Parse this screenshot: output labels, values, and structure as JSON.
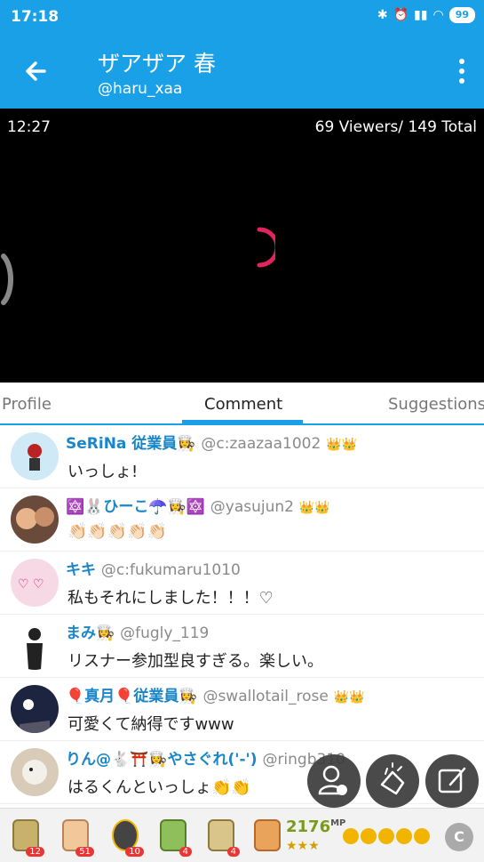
{
  "status": {
    "time": "17:18",
    "battery": "99"
  },
  "appbar": {
    "title": "ザアザア 春",
    "handle": "@haru_xaa"
  },
  "video": {
    "time": "12:27",
    "viewers": "69 Viewers/ 149 Total"
  },
  "tabs": [
    "Profile",
    "Comment",
    "Suggestions"
  ],
  "comments": [
    {
      "name": "SeRiNa 従業員👩‍🍳",
      "user": "@c:zaazaa1002",
      "badge": "👑👑",
      "message": "いっしょ!"
    },
    {
      "name": "🔯🐰ひーこ☂️👩‍🍳🔯",
      "user": "@yasujun2",
      "badge": "👑👑",
      "message": "👏🏻👏🏻👏🏻👏🏻👏🏻"
    },
    {
      "name": "キキ",
      "user": "@c:fukumaru1010",
      "badge": "",
      "message": "私もそれにしました！！！♡"
    },
    {
      "name": "まみ👩‍🍳",
      "user": "@fugly_119",
      "badge": "",
      "message": "リスナー参加型良すぎる。楽しい。"
    },
    {
      "name": "🎈真月🎈従業員👩‍🍳",
      "user": "@swallotail_rose",
      "badge": "👑👑",
      "message": "可愛くて納得ですwww"
    },
    {
      "name": "りん@🐇⛩️👩‍🍳やさぐれ('-')",
      "user": "@ringb310",
      "badge": "",
      "message": "はるくんといっしょ👏👏"
    }
  ],
  "gifts": [
    {
      "count": "12"
    },
    {
      "count": "51"
    },
    {
      "count": "10"
    },
    {
      "count": "4"
    },
    {
      "count": "4"
    }
  ],
  "points": {
    "value": "2176",
    "unit": "MP",
    "stars": "★★★"
  }
}
